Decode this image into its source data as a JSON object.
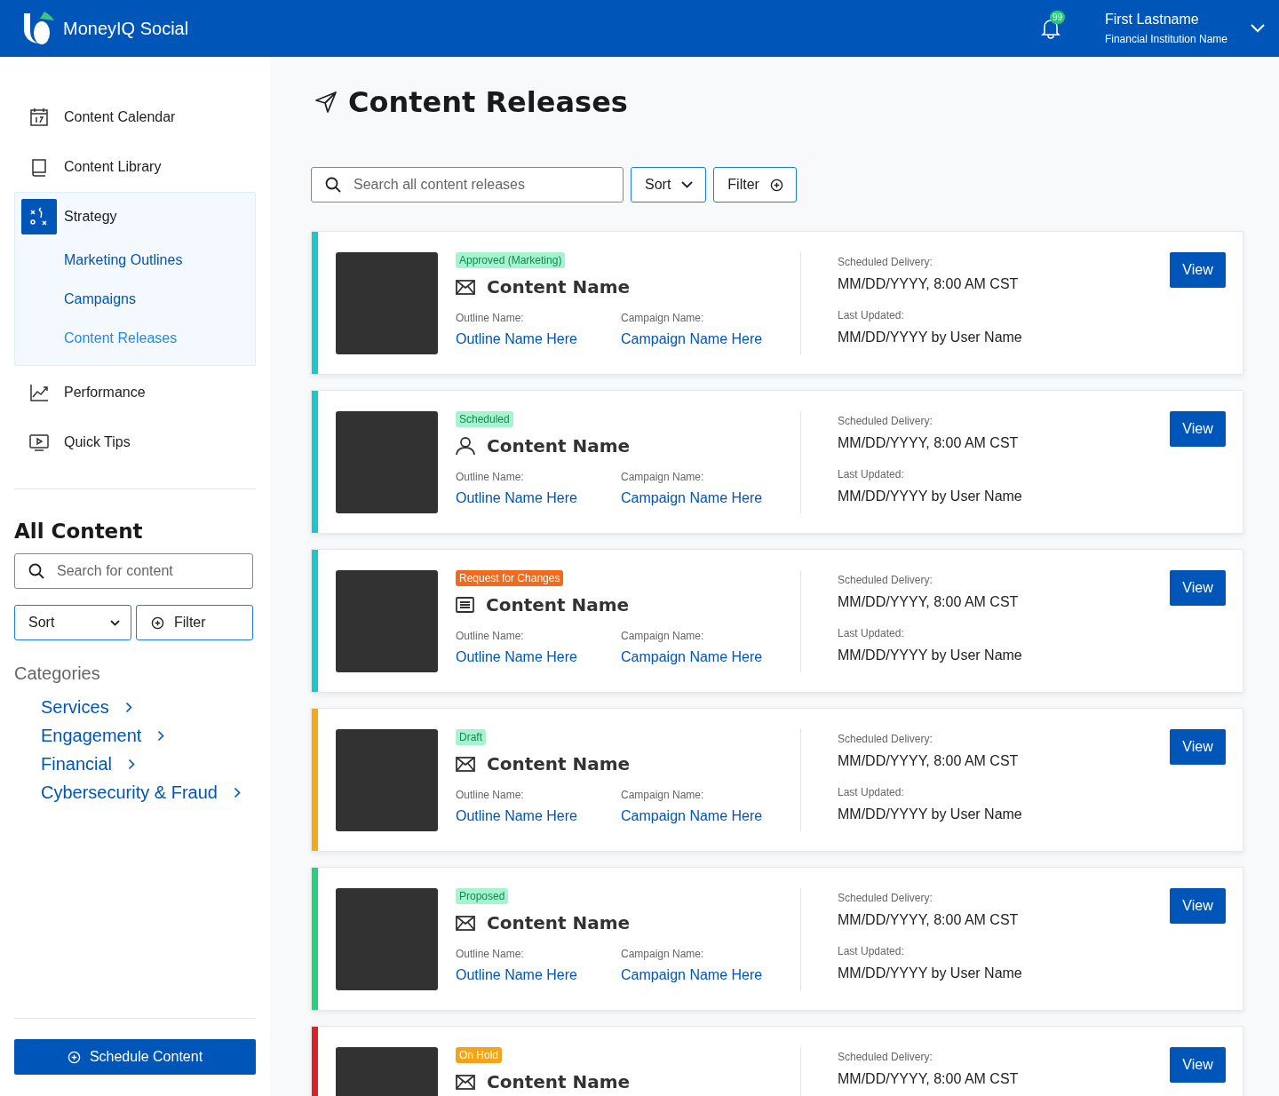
{
  "header": {
    "brand": "MoneyIQ Social",
    "notification_count": "99",
    "user_name": "First Lastname",
    "institution": "Financial Institution Name"
  },
  "sidebar": {
    "items": [
      {
        "label": "Content Calendar",
        "kind": "calendar",
        "selected": false,
        "expanded": false
      },
      {
        "label": "Content Library",
        "kind": "book",
        "selected": false,
        "expanded": false
      },
      {
        "label": "Strategy",
        "kind": "strategy",
        "selected": true,
        "expanded": true,
        "children": [
          {
            "label": "Marketing Outlines",
            "selected": false
          },
          {
            "label": "Campaigns",
            "selected": false
          },
          {
            "label": "Content Releases",
            "selected": true
          }
        ]
      },
      {
        "label": "Performance",
        "kind": "chart",
        "selected": false,
        "expanded": false
      },
      {
        "label": "Quick Tips",
        "kind": "video",
        "selected": false,
        "expanded": false
      }
    ],
    "all_content": {
      "title": "All Content",
      "search_placeholder": "Search for content",
      "sort": "Sort",
      "filter": "Filter",
      "categories_title": "Categories",
      "categories": [
        "Services",
        "Engagement",
        "Financial",
        "Cybersecurity & Fraud"
      ]
    },
    "schedule_button": "Schedule Content"
  },
  "main": {
    "title": "Content Releases",
    "search_placeholder": "Search all content releases",
    "sort": "Sort",
    "filter": "Filter",
    "releases": [
      {
        "color": "#1fc6c9",
        "status": {
          "label": "Approved (Marketing)",
          "kind": "success"
        },
        "kind": "mail",
        "name": "Content Name",
        "outline_label": "Outline Name:",
        "outline": "Outline Name Here",
        "campaign_label": "Campaign Name:",
        "campaign": "Campaign Name Here",
        "delivery_label": "Scheduled Delivery:",
        "delivery": "MM/DD/YYYY, 8:00 AM CST",
        "updated_label": "Last Updated:",
        "updated": "MM/DD/YYYY by User Name",
        "action": "View"
      },
      {
        "color": "#1fc6c9",
        "status": {
          "label": "Scheduled",
          "kind": "success"
        },
        "kind": "person",
        "name": "Content Name",
        "outline_label": "Outline Name:",
        "outline": "Outline Name Here",
        "campaign_label": "Campaign Name:",
        "campaign": "Campaign Name Here",
        "delivery_label": "Scheduled Delivery:",
        "delivery": "MM/DD/YYYY, 8:00 AM CST",
        "updated_label": "Last Updated:",
        "updated": "MM/DD/YYYY by User Name",
        "action": "View"
      },
      {
        "color": "#1fc6c9",
        "status": {
          "label": "Request for Changes",
          "kind": "alert"
        },
        "kind": "document",
        "name": "Content Name",
        "outline_label": "Outline Name:",
        "outline": "Outline Name Here",
        "campaign_label": "Campaign Name:",
        "campaign": "Campaign Name Here",
        "delivery_label": "Scheduled Delivery:",
        "delivery": "MM/DD/YYYY, 8:00 AM CST",
        "updated_label": "Last Updated:",
        "updated": "MM/DD/YYYY by User Name",
        "action": "View"
      },
      {
        "color": "#f5a81c",
        "status": {
          "label": "Draft",
          "kind": "success"
        },
        "kind": "mail",
        "name": "Content Name",
        "outline_label": "Outline Name:",
        "outline": "Outline Name Here",
        "campaign_label": "Campaign Name:",
        "campaign": "Campaign Name Here",
        "delivery_label": "Scheduled Delivery:",
        "delivery": "MM/DD/YYYY, 8:00 AM CST",
        "updated_label": "Last Updated:",
        "updated": "MM/DD/YYYY by User Name",
        "action": "View"
      },
      {
        "color": "#27d07a",
        "status": {
          "label": "Proposed",
          "kind": "success"
        },
        "kind": "mail",
        "name": "Content Name",
        "outline_label": "Outline Name:",
        "outline": "Outline Name Here",
        "campaign_label": "Campaign Name:",
        "campaign": "Campaign Name Here",
        "delivery_label": "Scheduled Delivery:",
        "delivery": "MM/DD/YYYY, 8:00 AM CST",
        "updated_label": "Last Updated:",
        "updated": "MM/DD/YYYY by User Name",
        "action": "View"
      },
      {
        "color": "#d9232a",
        "status": {
          "label": "On Hold",
          "kind": "hold"
        },
        "kind": "mail",
        "name": "Content Name",
        "delivery_label": "Scheduled Delivery:",
        "delivery": "MM/DD/YYYY, 8:00 AM CST",
        "action": "View"
      }
    ]
  }
}
